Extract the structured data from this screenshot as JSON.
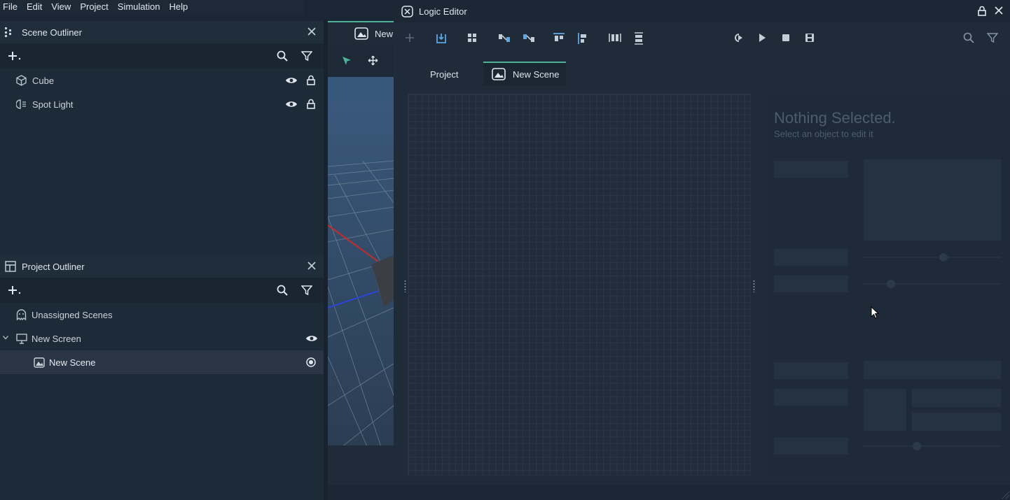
{
  "menu": [
    "File",
    "Edit",
    "View",
    "Project",
    "Simulation",
    "Help"
  ],
  "scene_outliner": {
    "title": "Scene Outliner",
    "items": [
      {
        "label": "Cube",
        "icon": "cube-icon"
      },
      {
        "label": "Spot Light",
        "icon": "spotlight-icon"
      }
    ]
  },
  "project_outliner": {
    "title": "Project Outliner",
    "items": [
      {
        "label": "Unassigned Scenes",
        "icon": "ghost-icon"
      },
      {
        "label": "New Screen",
        "icon": "monitor-icon"
      },
      {
        "label": "New Scene",
        "icon": "scene-icon"
      }
    ]
  },
  "viewport": {
    "tab_label": "New"
  },
  "logic_editor": {
    "title": "Logic Editor",
    "tabs": [
      "Project",
      "New Scene"
    ],
    "active_tab": "New Scene",
    "empty_title": "Nothing Selected.",
    "empty_hint": "Select an object to edit it"
  },
  "colors": {
    "accent": "#4fb39a",
    "background": "#1b2734"
  }
}
